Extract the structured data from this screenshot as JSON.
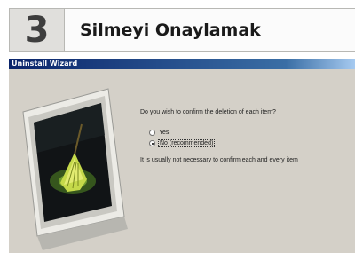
{
  "header": {
    "step_number": "3",
    "title": "Silmeyi Onaylamak"
  },
  "window": {
    "title": "Uninstall Wizard",
    "question": "Do you wish to confirm the deletion of each item?",
    "options": [
      {
        "label": "Yes",
        "selected": false
      },
      {
        "label": "No (recommended)",
        "selected": true
      }
    ],
    "note": "It is usually not necessary to confirm each and every item"
  },
  "icons": {
    "illustration": "crt-monitor-with-broom-icon"
  },
  "colors": {
    "titlebar_start": "#0a246a",
    "titlebar_end": "#a6caf0",
    "dialog_bg": "#d4d0c8",
    "header_box": "#e0dfdc"
  }
}
